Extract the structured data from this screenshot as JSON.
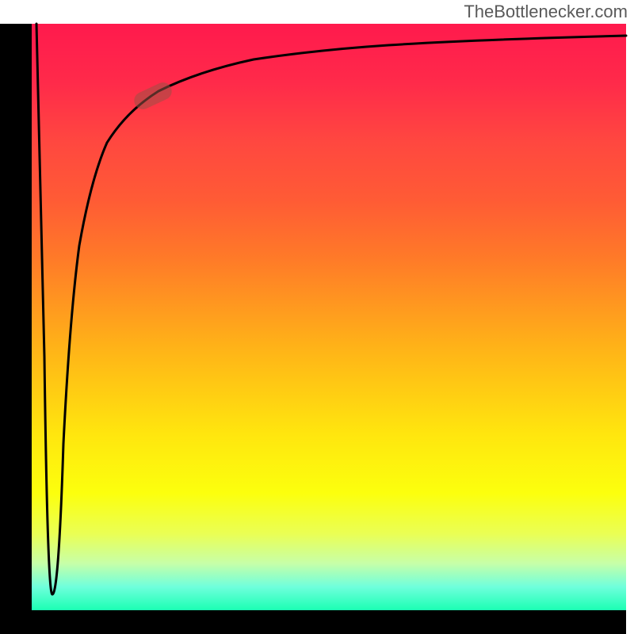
{
  "watermark": "TheBottlenecker.com",
  "chart_data": {
    "type": "line",
    "title": "",
    "xlabel": "",
    "ylabel": "",
    "xlim": [
      0,
      100
    ],
    "ylim": [
      0,
      100
    ],
    "background_gradient": {
      "top_color": "#ff1a4d",
      "bottom_color": "#1bffb3",
      "note": "red (high/bad) at top, green (low/good) at bottom"
    },
    "series": [
      {
        "name": "bottleneck-curve",
        "note": "values estimated from pixel positions; y=0 at bottom (green), y=100 at top (red)",
        "x": [
          0,
          1,
          2,
          3,
          4,
          5,
          6,
          8,
          10,
          12,
          15,
          18,
          20,
          25,
          30,
          40,
          50,
          60,
          70,
          80,
          90,
          100
        ],
        "y": [
          100,
          40,
          3,
          30,
          55,
          66,
          73,
          80,
          84,
          86,
          88,
          89,
          90,
          91,
          92,
          93.5,
          94.5,
          95,
          95.5,
          96,
          96.3,
          96.5
        ]
      }
    ],
    "marker": {
      "name": "selected-point",
      "x": 18,
      "y": 89,
      "shape": "rounded-bar",
      "color": "rgba(155,80,70,0.55)"
    }
  },
  "colors": {
    "axis": "#000000",
    "curve": "#000000",
    "watermark_text": "#595959"
  }
}
